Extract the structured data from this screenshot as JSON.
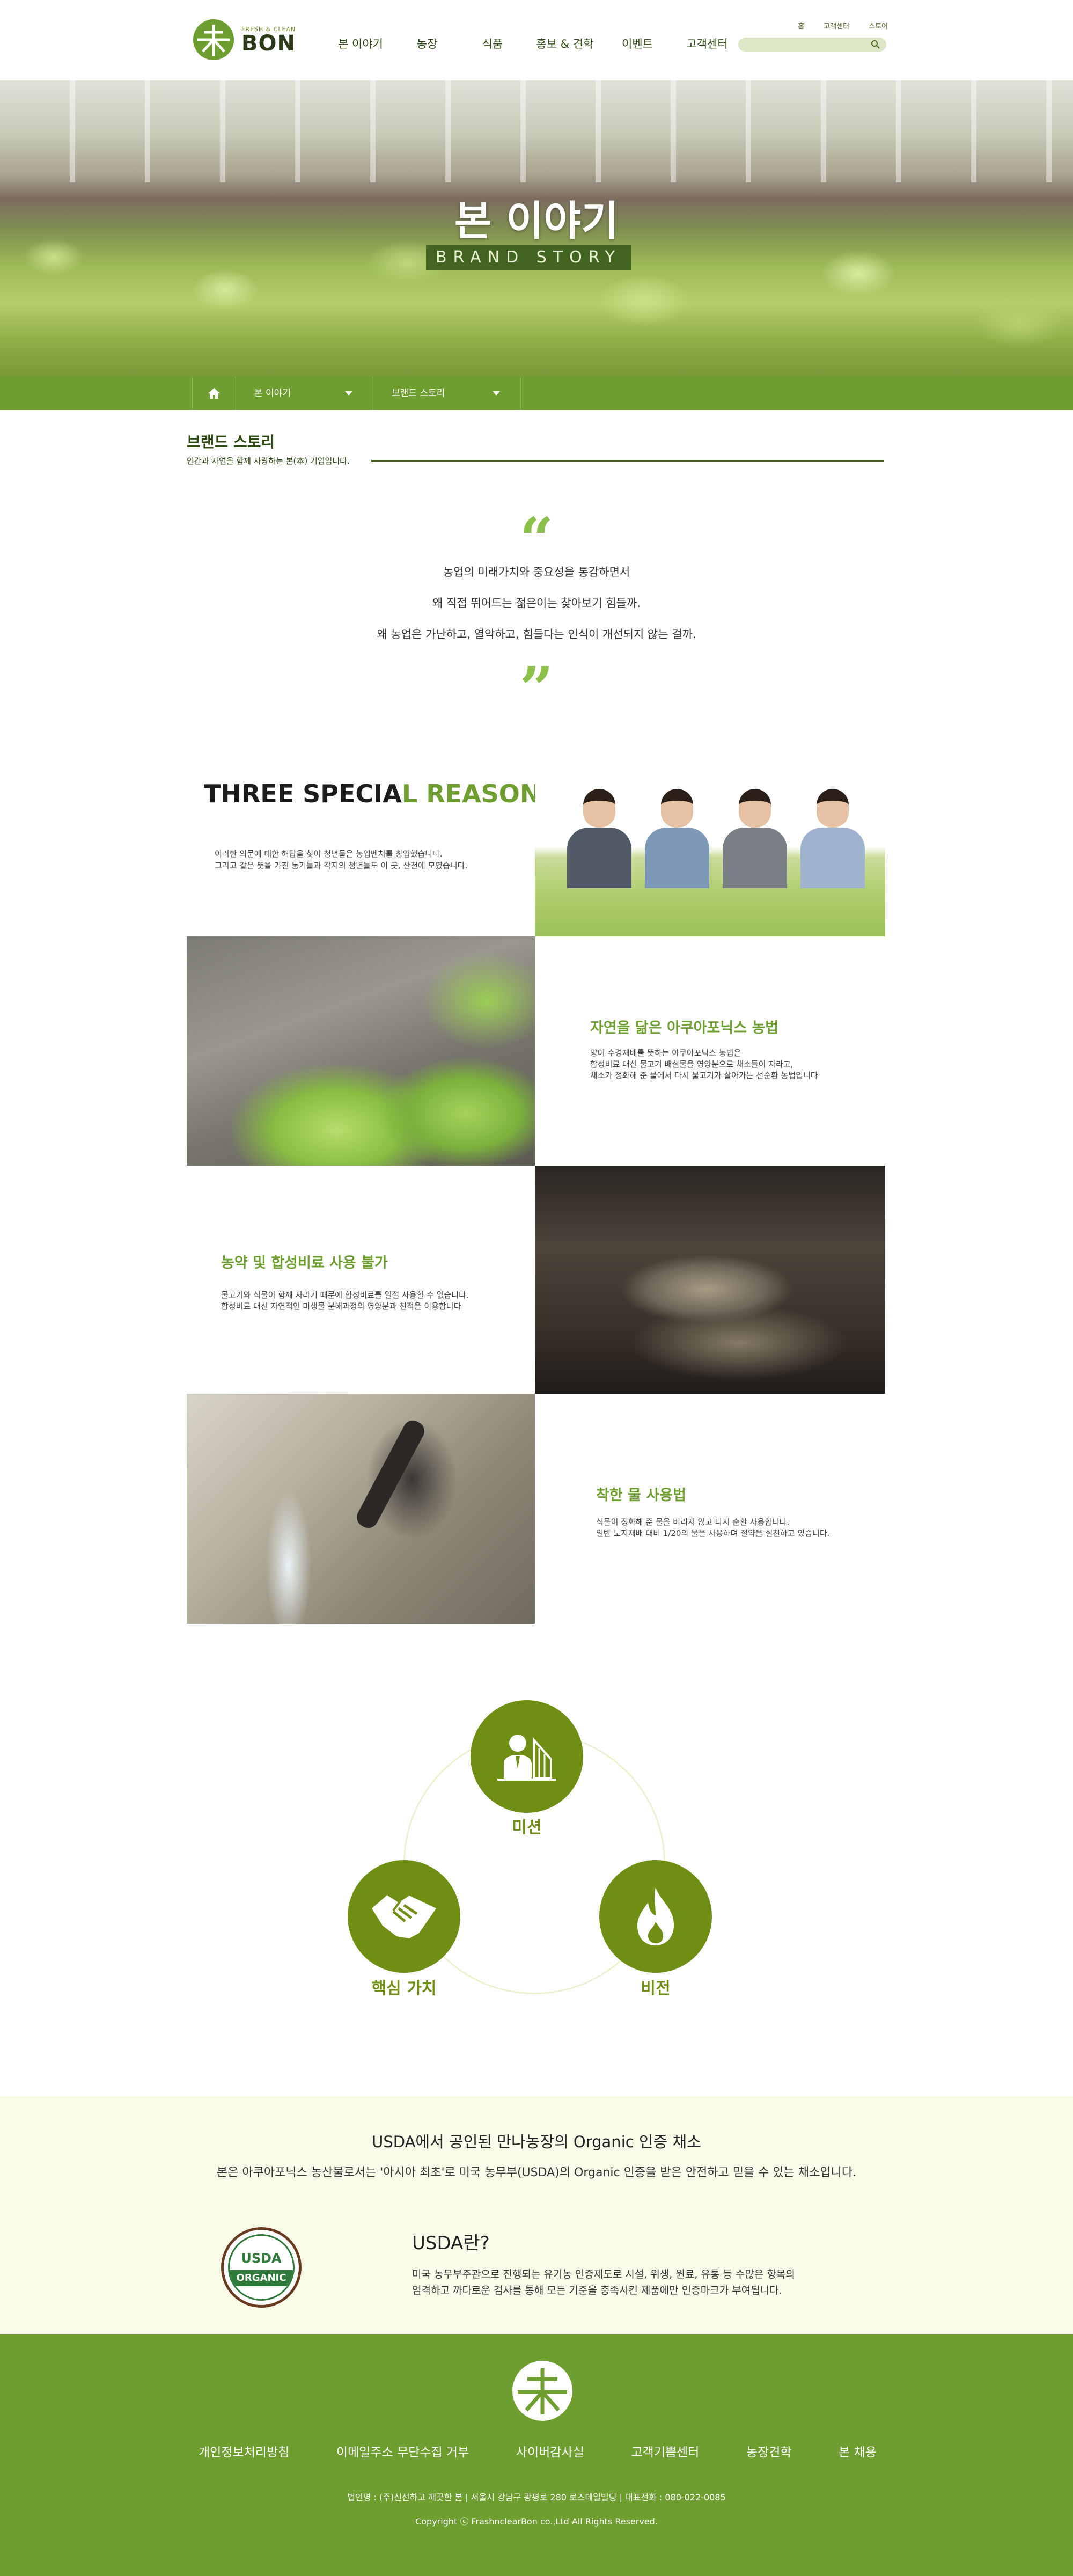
{
  "header": {
    "logo_small": "FRESH & CLEAN",
    "logo_text": "BON",
    "nav": [
      "본 이야기",
      "농장",
      "식품",
      "홍보 & 견학",
      "이벤트",
      "고객센터"
    ],
    "util": [
      "홈",
      "고객센터",
      "스토어"
    ],
    "search_placeholder": ""
  },
  "hero": {
    "title": "본 이야기",
    "subtitle": "BRAND STORY"
  },
  "location": {
    "depth1": "본 이야기",
    "depth2": "브랜드 스토리"
  },
  "section": {
    "title": "브랜드 스토리",
    "desc": "인간과 자연을 함께 사랑하는 본(本) 기업입니다."
  },
  "quote": {
    "open": "“",
    "close": "”",
    "lines": [
      "농업의 미래가치와 중요성을 통감하면서",
      "왜 직접 뛰어드는 젊은이는 찾아보기 힘들까.",
      "왜 농업은 가난하고, 열악하고, 힘들다는 인식이 개선되지 않는 걸까."
    ]
  },
  "reasons": {
    "title_dark": "THREE SPECIA",
    "title_green": "L REASONS",
    "intro": [
      "이러한 의문에 대한 해답을 찾아 청년들은 농업벤처를 창업했습니다.",
      "그리고 같은 뜻을 가진 동기들과 각지의 청년들도 이 곳, 산천에 모였습니다."
    ],
    "items": [
      {
        "heading": "자연을 닮은 아쿠아포닉스 농법",
        "lines": [
          "양어 수경재배를 뜻하는 아쿠아포닉스 농법은",
          "합성비료 대신 물고기 배설물을 영양분으로 채소들이 자라고,",
          "채소가 정화해 준 물에서 다시 물고기가 살아가는 선순환 농법입니다"
        ]
      },
      {
        "heading": "농약 및 합성비료 사용 불가",
        "lines": [
          "물고기와 식물이 함께 자라기 때문에 합성비료를 일절 사용할 수 없습니다.",
          "합성비료 대신 자연적인 미생물 분해과정의 영양분과 천적을 이용합니다"
        ]
      },
      {
        "heading": "착한 물 사용법",
        "lines": [
          "식물이 정화해 준 물을 버리지 않고 다시 순환 사용합니다.",
          "일반 노지재배 대비 1/20의 물을 사용하며 절약을 실천하고 있습니다."
        ]
      }
    ]
  },
  "values": {
    "mission": "미션",
    "core": "핵심 가치",
    "vision": "비전"
  },
  "usda": {
    "title": "USDA에서 공인된 만나농장의 Organic 인증 채소",
    "subtitle": "본은 아쿠아포닉스 농산물로서는 '아시아 최초'로 미국 농무부(USDA)의 Organic 인증을 받은 안전하고 믿을 수 있는 채소입니다.",
    "seal_top": "USDA",
    "seal_band": "ORGANIC",
    "what_title": "USDA란?",
    "what_body": [
      "미국 농무부주관으로 진행되는 유기농 인증제도로 시설, 위생, 원료, 유통 등 수많은 항목의",
      "엄격하고 까다로운 검사를 통해 모든 기준을 충족시킨 제품에만 인증마크가 부여됩니다."
    ]
  },
  "footer": {
    "menu": [
      "개인정보처리방침",
      "이메일주소 무단수집 거부",
      "사이버감사실",
      "고객기쁨센터",
      "농장견학",
      "본 채용"
    ],
    "info": "법인명 : (주)신선하고 깨끗한 본   |   서울시 강남구 광평로 280 로즈데일빌딩   |   대표전화 : 080-022-0085",
    "copyright": "Copyright ⓒ FrashnclearBon co.,Ltd All Rights Reserved."
  },
  "colors": {
    "brand_green": "#6e9e30",
    "dark_green": "#2c4a12",
    "olive": "#6e8e14"
  }
}
